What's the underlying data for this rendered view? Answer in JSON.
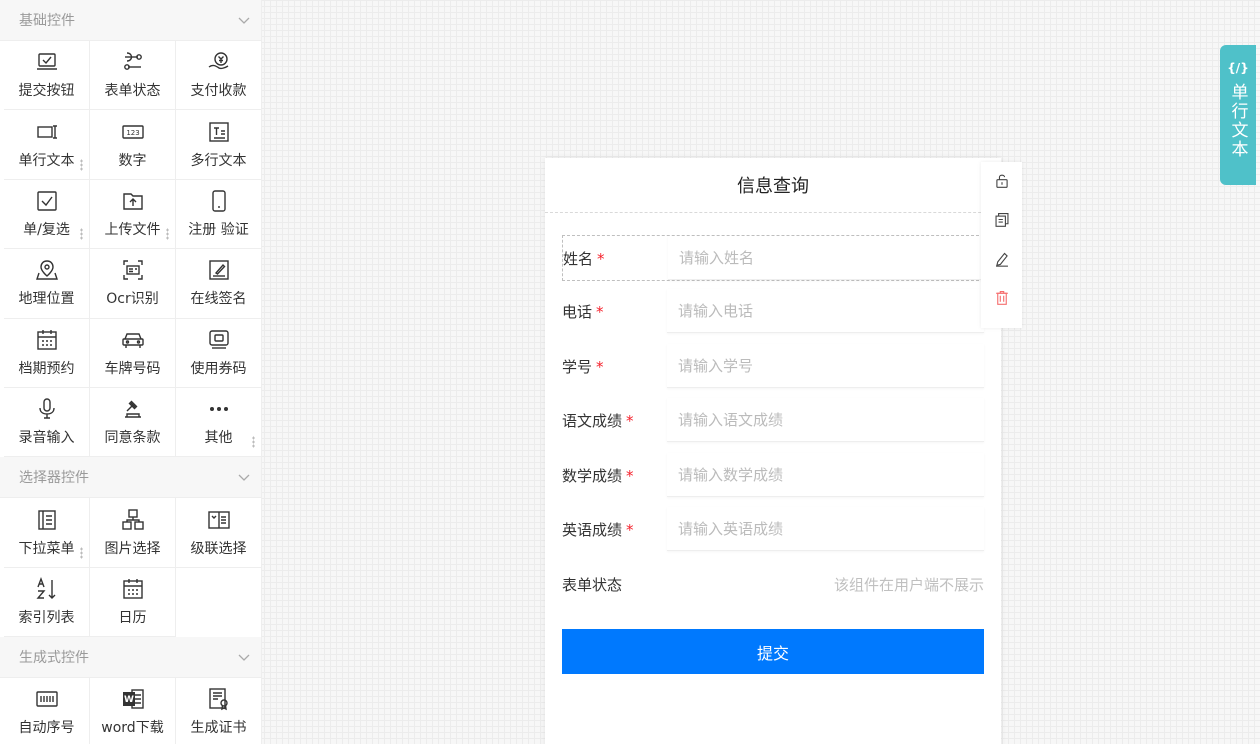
{
  "palette": {
    "groups": [
      {
        "title": "基础控件",
        "items": [
          {
            "label": "提交按钮",
            "icon": "submit-icon"
          },
          {
            "label": "表单状态",
            "icon": "status-icon"
          },
          {
            "label": "支付收款",
            "icon": "payment-icon"
          },
          {
            "label": "单行文本",
            "icon": "single-line-text-icon"
          },
          {
            "label": "数字",
            "icon": "number-icon"
          },
          {
            "label": "多行文本",
            "icon": "multi-line-text-icon"
          },
          {
            "label": "单/复选",
            "icon": "checkbox-icon"
          },
          {
            "label": "上传文件",
            "icon": "upload-icon"
          },
          {
            "label": "注册 验证",
            "icon": "phone-icon"
          },
          {
            "label": "地理位置",
            "icon": "location-icon"
          },
          {
            "label": "Ocr识别",
            "icon": "ocr-icon"
          },
          {
            "label": "在线签名",
            "icon": "signature-icon"
          },
          {
            "label": "档期预约",
            "icon": "calendar-icon"
          },
          {
            "label": "车牌号码",
            "icon": "car-icon"
          },
          {
            "label": "使用券码",
            "icon": "coupon-icon"
          },
          {
            "label": "录音输入",
            "icon": "microphone-icon"
          },
          {
            "label": "同意条款",
            "icon": "gavel-icon"
          },
          {
            "label": "其他",
            "icon": "more-icon"
          }
        ]
      },
      {
        "title": "选择器控件",
        "items": [
          {
            "label": "下拉菜单",
            "icon": "dropdown-icon"
          },
          {
            "label": "图片选择",
            "icon": "image-select-icon"
          },
          {
            "label": "级联选择",
            "icon": "cascader-icon"
          },
          {
            "label": "索引列表",
            "icon": "sort-az-icon"
          },
          {
            "label": "日历",
            "icon": "calendar-icon"
          }
        ]
      },
      {
        "title": "生成式控件",
        "items": [
          {
            "label": "自动序号",
            "icon": "serial-number-icon"
          },
          {
            "label": "word下载",
            "icon": "word-icon"
          },
          {
            "label": "生成证书",
            "icon": "certificate-icon"
          }
        ]
      }
    ]
  },
  "form": {
    "title": "信息查询",
    "fields": [
      {
        "label": "姓名",
        "placeholder": "请输入姓名",
        "required": "*"
      },
      {
        "label": "电话",
        "placeholder": "请输入电话",
        "required": "*"
      },
      {
        "label": "学号",
        "placeholder": "请输入学号",
        "required": "*"
      },
      {
        "label": "语文成绩",
        "placeholder": "请输入语文成绩",
        "required": "*"
      },
      {
        "label": "数学成绩",
        "placeholder": "请输入数学成绩",
        "required": "*"
      },
      {
        "label": "英语成绩",
        "placeholder": "请输入英语成绩",
        "required": "*"
      }
    ],
    "status_label": "表单状态",
    "status_note": "该组件在用户端不展示",
    "submit_label": "提交"
  },
  "toolbar": {
    "icons": [
      "unlock-icon",
      "copy-icon",
      "edit-icon",
      "delete-icon"
    ]
  },
  "side_tab": {
    "code": "{/}",
    "label": "单行文本"
  },
  "colors": {
    "primary": "#0079fe",
    "side_tab": "#4fc1c9",
    "required": "#f5222d",
    "delete": "#f56c6c"
  }
}
